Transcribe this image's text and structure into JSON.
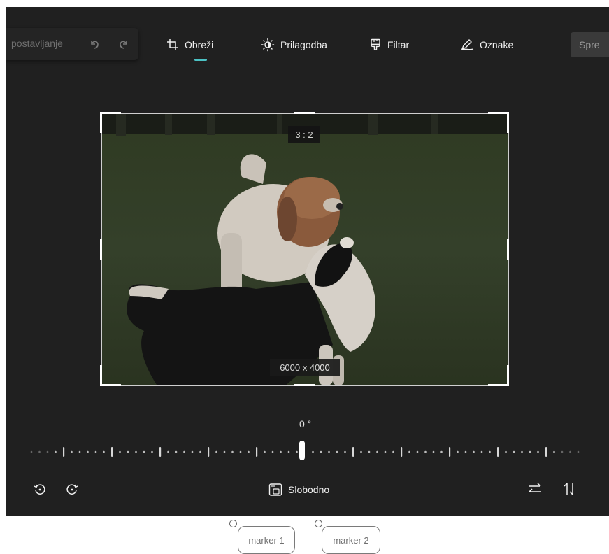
{
  "toolbar": {
    "reset_label": "postavljanje",
    "tools": [
      {
        "label": "Obreži",
        "icon": "crop-icon",
        "active": true
      },
      {
        "label": "Prilagodba",
        "icon": "brightness-icon"
      },
      {
        "label": "Filtar",
        "icon": "filter-icon"
      },
      {
        "label": "Oznake",
        "icon": "markup-icon"
      }
    ],
    "save_label": "Spre"
  },
  "crop": {
    "aspect_label": "3 : 2",
    "size_label": "6000 x 4000"
  },
  "rotation": {
    "angle_label": "0 °",
    "angle_value": 0
  },
  "bottom": {
    "aspect_mode_label": "Slobodno"
  },
  "markers": [
    "marker 1",
    "marker 2"
  ],
  "colors": {
    "background": "#202020",
    "accent": "#4cc2c4",
    "text": "#f0f0f0"
  }
}
